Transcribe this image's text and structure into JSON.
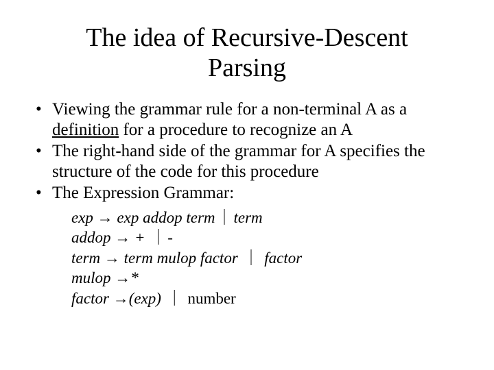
{
  "title": "The idea of Recursive-Descent Parsing",
  "bullets": {
    "b1_pre": "Viewing the grammar rule for a non-terminal A as a ",
    "b1_def": "definition",
    "b1_post": " for a procedure to recognize an A",
    "b2": "The right-hand side of the grammar for A specifies the structure of the code for this procedure",
    "b3": "The Expression Grammar:"
  },
  "grammar": {
    "l1_lhs": "exp",
    "l1_rhs1": "exp addop term",
    "l1_rhs2": "term",
    "l2_lhs": "addop",
    "l2_rhs1": "+",
    "l2_rhs2": "-",
    "l3_lhs": "term",
    "l3_rhs1": "term mulop factor",
    "l3_rhs2": "factor",
    "l4_lhs": "mulop",
    "l4_rhs1": "*",
    "l5_lhs": "factor",
    "l5_rhs1": "(exp)",
    "l5_rhs2": "number"
  },
  "symbols": {
    "arrow": "→",
    "pipe": "｜"
  }
}
